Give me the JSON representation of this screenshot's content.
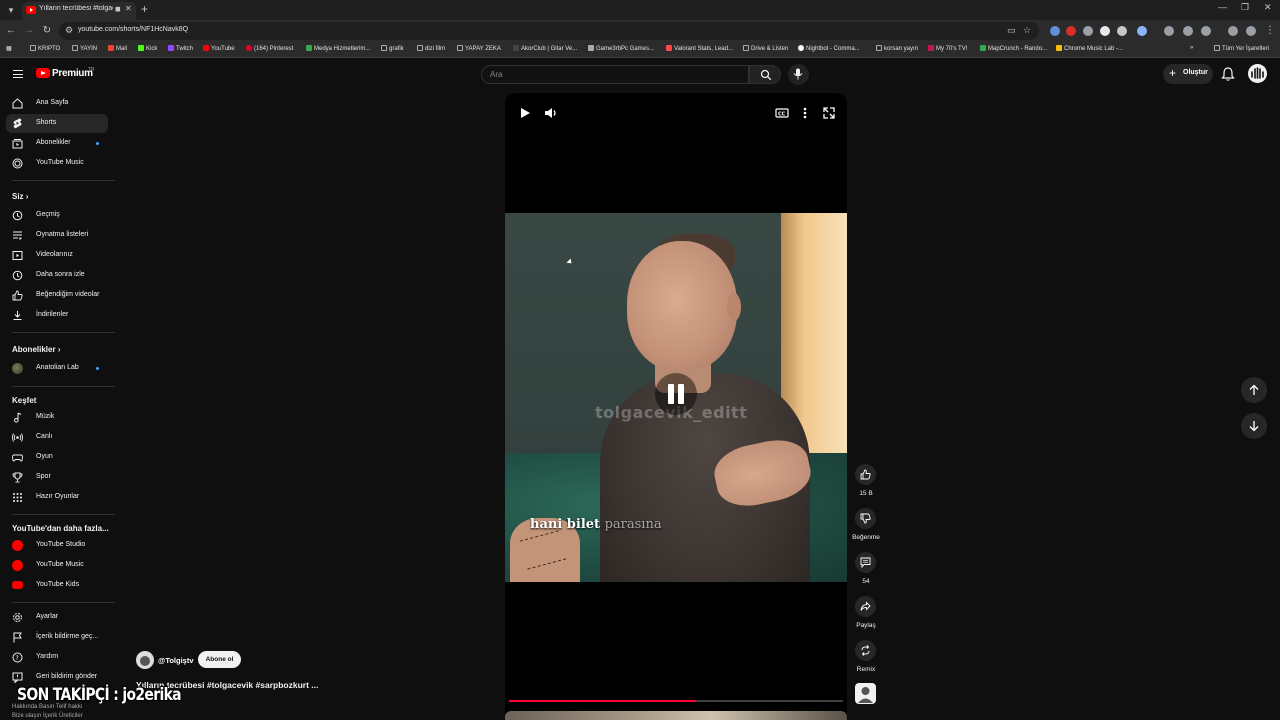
{
  "browser": {
    "tab_title": "Yılların tecrübesi #tolgacevik",
    "url": "youtube.com/shorts/NF1HcNavk8Q",
    "bookmarks": [
      "KRIPTO",
      "YAYIN",
      "Mail",
      "Kick",
      "Twitch",
      "YouTube",
      "(164) Pinterest",
      "Medya Hizmetlerim...",
      "grafik",
      "dizi film",
      "YAPAY ZEKA",
      "AkorClub | Gitar Ve...",
      "Game3rbPc Games...",
      "Valorant Stats, Lead...",
      "Drive & Listen",
      "Nightbot - Comma...",
      "korsan yayın",
      "My 70's TV!",
      "MapCrunch - Rando...",
      "Chrome Music Lab -..."
    ],
    "all_bookmarks": "Tüm Yer İşaretleri"
  },
  "header": {
    "logo_text": "Premium",
    "logo_sup": "TR",
    "search_placeholder": "Ara",
    "create_label": "Oluştur"
  },
  "sidebar": {
    "main": [
      "Ana Sayfa",
      "Shorts",
      "Abonelikler",
      "YouTube Music"
    ],
    "you_title": "Siz",
    "you": [
      "Geçmiş",
      "Oynatma listeleri",
      "Videolarınız",
      "Daha sonra izle",
      "Beğendiğim videolar",
      "İndirilenler"
    ],
    "subs_title": "Abonelikler",
    "subs": [
      "Anatolian Lab"
    ],
    "explore_title": "Keşfet",
    "explore": [
      "Müzik",
      "Canlı",
      "Oyun",
      "Spor",
      "Hazır Oyunlar"
    ],
    "more_title": "YouTube'dan daha fazla...",
    "more": [
      "YouTube Studio",
      "YouTube Music",
      "YouTube Kids"
    ],
    "settings": [
      "Ayarlar",
      "İçerik bildirme geç...",
      "Yardım",
      "Geri bildirim gönder"
    ],
    "footer": [
      "Hakkında  Basın  Telif hakkı",
      "Bize ulaşın  İçerik Üreticiler"
    ]
  },
  "short": {
    "watermark": "tolgacevik_editt",
    "caption_bold": "hani bilet",
    "caption_dim": "parasına",
    "progress": 0.56,
    "channel": "@Tolgiştv",
    "subscribe": "Abone ol",
    "title": "Yılların tecrübesi #tolgacevik #sarpbozkurt ...",
    "likes": "15 B",
    "dislike": "Beğenme",
    "comments": "54",
    "share": "Paylaş",
    "remix": "Remix"
  },
  "stream_overlay": "SON TAKİPÇİ : jo2erika",
  "colors": {
    "accent": "#ff0033",
    "brand": "#ff0000",
    "background": "#0f0f0f"
  }
}
